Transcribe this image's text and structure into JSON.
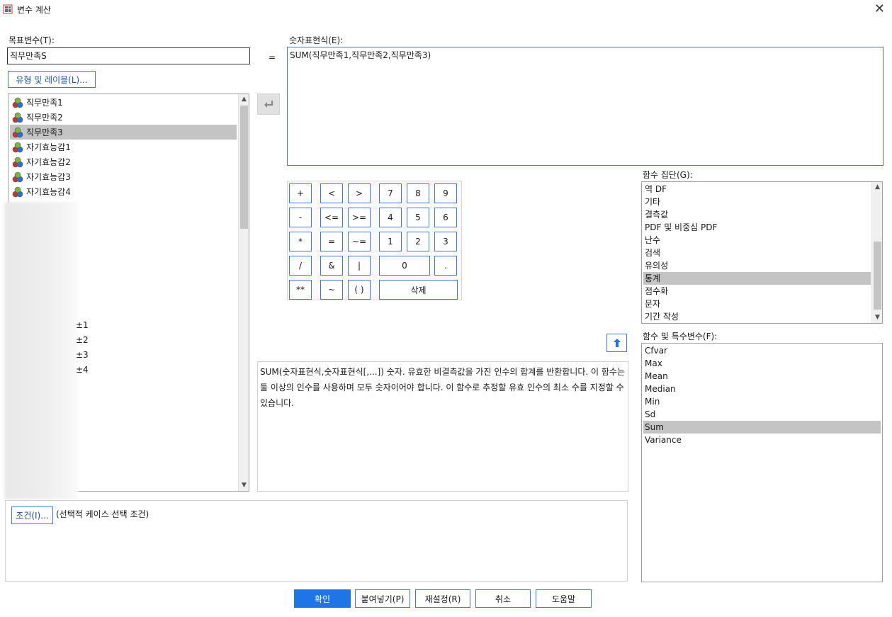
{
  "window": {
    "title": "변수 계산",
    "close_glyph": "✕"
  },
  "target": {
    "label": "목표변수(T):",
    "value": "직무만족S",
    "type_label_button": "유형 및 레이블(L)..."
  },
  "equals": "=",
  "expression": {
    "label": "숫자표현식(E):",
    "value": "SUM(직무만족1,직무만족2,직무만족3)"
  },
  "variables": [
    {
      "name": "직무만족1",
      "selected": false
    },
    {
      "name": "직무만족2",
      "selected": false
    },
    {
      "name": "직무만족3",
      "selected": true
    },
    {
      "name": "자기효능감1",
      "selected": false
    },
    {
      "name": "자기효능감2",
      "selected": false
    },
    {
      "name": "자기효능감3",
      "selected": false
    },
    {
      "name": "자기효능감4",
      "selected": false
    }
  ],
  "variables_partial": [
    "±1",
    "±2",
    "±3",
    "±4"
  ],
  "transfer_arrow_glyph": "↵",
  "keypad": {
    "row1": [
      "+",
      "<",
      ">",
      "7",
      "8",
      "9"
    ],
    "row2": [
      "-",
      "<=",
      ">=",
      "4",
      "5",
      "6"
    ],
    "row3": [
      "*",
      "=",
      "~=",
      "1",
      "2",
      "3"
    ],
    "row4": [
      "/",
      "&",
      "|",
      "0",
      "."
    ],
    "row5": [
      "**",
      "~",
      "( )",
      "삭제"
    ]
  },
  "function_group": {
    "label": "함수 집단(G):",
    "items": [
      {
        "label": "역 DF",
        "selected": false
      },
      {
        "label": "기타",
        "selected": false
      },
      {
        "label": "결측값",
        "selected": false
      },
      {
        "label": "PDF 및 비중심 PDF",
        "selected": false
      },
      {
        "label": "난수",
        "selected": false
      },
      {
        "label": "검색",
        "selected": false
      },
      {
        "label": "유의성",
        "selected": false
      },
      {
        "label": "통계",
        "selected": true
      },
      {
        "label": "점수화",
        "selected": false
      },
      {
        "label": "문자",
        "selected": false
      },
      {
        "label": "기간 작성",
        "selected": false
      }
    ]
  },
  "up_arrow_glyph": "🡅",
  "description": "SUM(숫자표현식,숫자표현식[,...]) 숫자. 유효한 비결측값을 가진 인수의 합계를 반환합니다. 이 함수는 둘 이상의 인수를 사용하며 모두 숫자이어야 합니다. 이 함수로 추정할 유효 인수의 최소 수를 지정할 수 있습니다.",
  "functions": {
    "label": "함수 및 특수변수(F):",
    "items": [
      {
        "label": "Cfvar",
        "selected": false
      },
      {
        "label": "Max",
        "selected": false
      },
      {
        "label": "Mean",
        "selected": false
      },
      {
        "label": "Median",
        "selected": false
      },
      {
        "label": "Min",
        "selected": false
      },
      {
        "label": "Sd",
        "selected": false
      },
      {
        "label": "Sum",
        "selected": true
      },
      {
        "label": "Variance",
        "selected": false
      }
    ]
  },
  "condition": {
    "button": "조건(I)...",
    "text": "(선택적 케이스 선택 조건)"
  },
  "footer": {
    "ok": "확인",
    "paste": "붙여넣기(P)",
    "reset": "재설정(R)",
    "cancel": "취소",
    "help": "도움말"
  },
  "colors": {
    "accent": "#1f74e6",
    "selection": "#c4c4c4",
    "border_blue": "#3d7bd6"
  }
}
